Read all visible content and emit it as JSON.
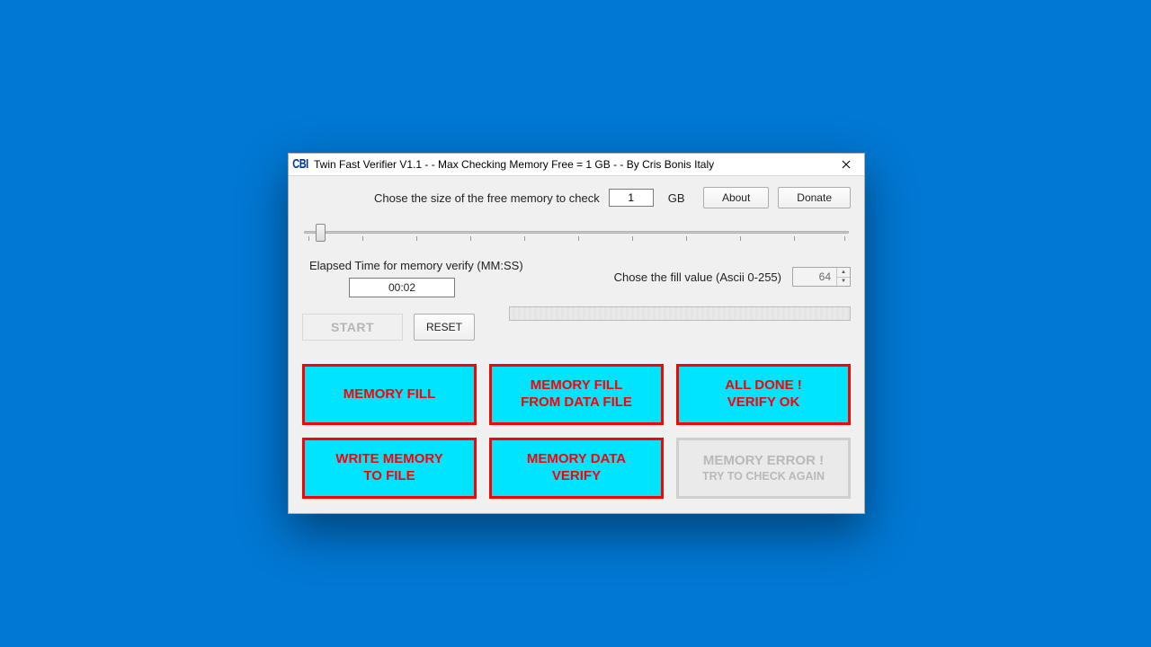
{
  "titlebar": {
    "icon_text": "CBI",
    "title": "Twin Fast Verifier V1.1 - - Max Checking Memory Free = 1 GB - - By Cris Bonis Italy"
  },
  "top": {
    "size_label": "Chose the size of the free memory to check",
    "size_value": "1",
    "size_unit": "GB",
    "about": "About",
    "donate": "Donate"
  },
  "elapsed": {
    "label": "Elapsed Time for memory verify (MM:SS)",
    "value": "00:02"
  },
  "fill": {
    "label": "Chose the fill value (Ascii 0-255)",
    "value": "64"
  },
  "controls": {
    "start": "START",
    "reset": "RESET"
  },
  "panels": {
    "memory_fill": "MEMORY FILL",
    "memory_fill_file_l1": "MEMORY FILL",
    "memory_fill_file_l2": "FROM DATA FILE",
    "all_done_l1": "ALL DONE !",
    "all_done_l2": "VERIFY OK",
    "write_l1": "WRITE MEMORY",
    "write_l2": "TO FILE",
    "verify_l1": "MEMORY DATA",
    "verify_l2": "VERIFY",
    "error_l1": "MEMORY ERROR !",
    "error_l2": "TRY TO CHECK AGAIN"
  }
}
